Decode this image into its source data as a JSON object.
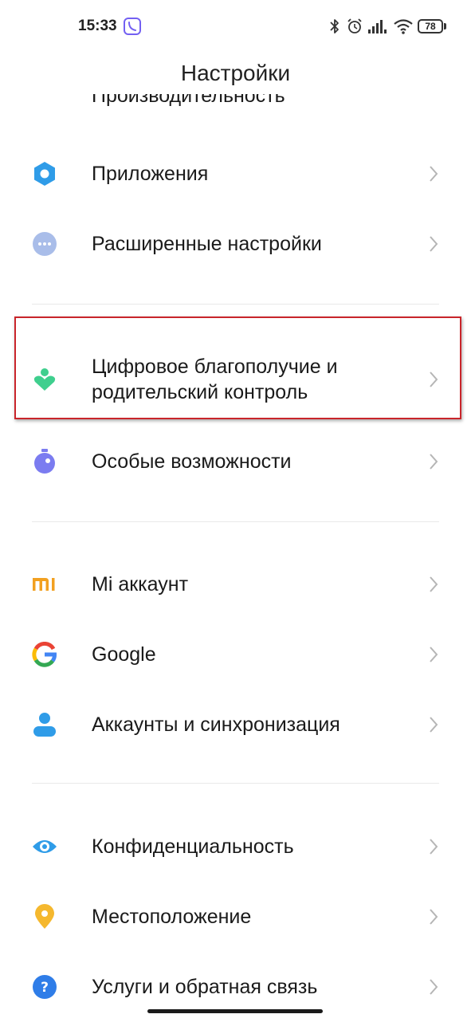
{
  "status_bar": {
    "time": "15:33",
    "battery": "78",
    "icons": [
      "viber-icon",
      "bluetooth-icon",
      "alarm-icon",
      "signal-icon",
      "wifi-icon",
      "battery-icon"
    ]
  },
  "header": {
    "title": "Настройки"
  },
  "partial_item": {
    "label": "Производительность"
  },
  "items": [
    {
      "label": "Приложения",
      "icon": "apps-gear-icon"
    },
    {
      "label": "Расширенные настройки",
      "icon": "more-dots-icon"
    },
    {
      "label": "Цифровое благополучие и родительский контроль",
      "icon": "wellbeing-icon"
    },
    {
      "label": "Особые возможности",
      "icon": "accessibility-icon"
    },
    {
      "label": "Mi аккаунт",
      "icon": "mi-logo-icon"
    },
    {
      "label": "Google",
      "icon": "google-icon"
    },
    {
      "label": "Аккаунты и синхронизация",
      "icon": "account-person-icon"
    },
    {
      "label": "Конфиденциальность",
      "icon": "privacy-eye-icon"
    },
    {
      "label": "Местоположение",
      "icon": "location-pin-icon"
    },
    {
      "label": "Услуги и обратная связь",
      "icon": "help-question-icon"
    }
  ],
  "colors": {
    "highlight_border": "#c9252b",
    "apps_blue": "#2f9ce8",
    "more_gray_blue": "#a9bde9",
    "wellbeing_green": "#3fcf8e",
    "accessibility_purple": "#7b7cf0",
    "mi_orange": "#f2a020"
  }
}
